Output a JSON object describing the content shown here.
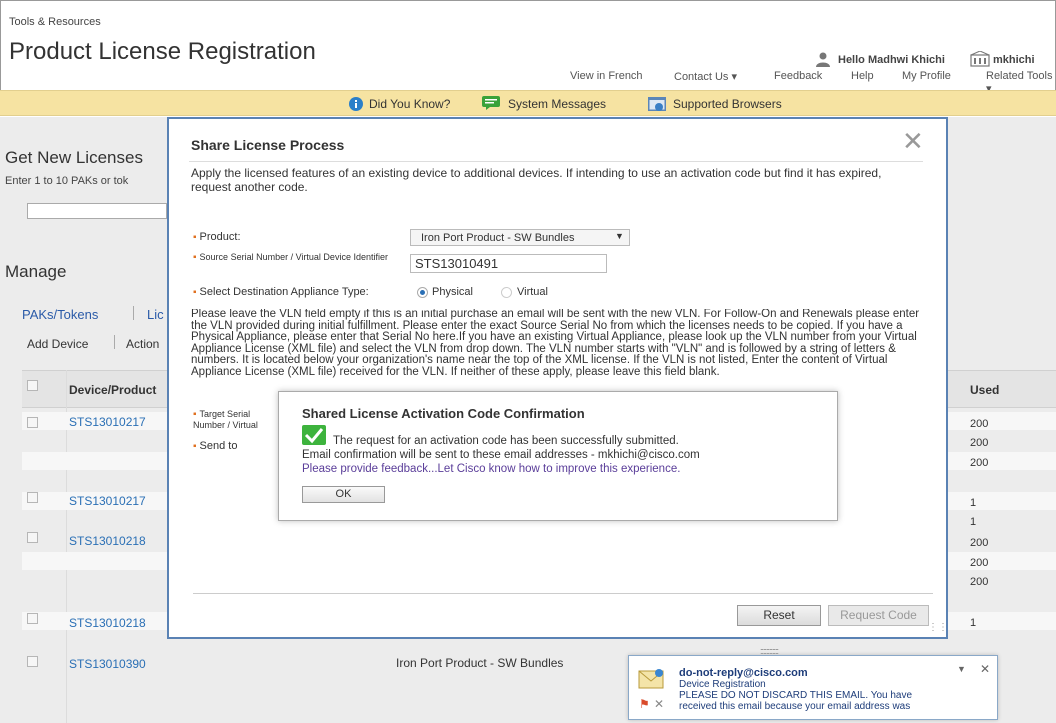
{
  "header": {
    "breadcrumb": "Tools & Resources",
    "title": "Product License Registration",
    "hello_user": "Hello Madhwi Khichi",
    "username": "mkhichi",
    "nav_links": [
      "View in French",
      "Contact Us ▾",
      "Feedback",
      "Help",
      "My Profile",
      "Related Tools ▾"
    ]
  },
  "info_bar": {
    "did_you_know": "Did You Know?",
    "system_messages": "System Messages",
    "supported_browsers": "Supported Browsers"
  },
  "background": {
    "get_new_licenses": "Get New Licenses",
    "enter_paks": "Enter 1 to 10 PAKs or tok",
    "manage": "Manage",
    "tab_paks": "PAKs/Tokens",
    "tab_lic": "Lic",
    "add_device": "Add Device",
    "action": "Action",
    "col_device": "Device/Product",
    "col_used": "Used",
    "rows": [
      {
        "device": "STS13010217",
        "used": "200"
      },
      {
        "device": "",
        "used": "200"
      },
      {
        "device": "",
        "used": "200"
      },
      {
        "device": "STS13010217",
        "used": "1"
      },
      {
        "device": "",
        "used": "1"
      },
      {
        "device": "STS13010218",
        "used": "200"
      },
      {
        "device": "",
        "used": "200"
      },
      {
        "device": "",
        "used": "200"
      },
      {
        "device": "STS13010218",
        "used": "1"
      },
      {
        "device": "STS13010390",
        "used": ""
      }
    ],
    "row_product": "Iron Port Product - SW Bundles"
  },
  "modal": {
    "title": "Share License Process",
    "close": "✕",
    "description": "Apply the licensed features of an existing device to additional devices. If intending to use an activation code but find it has expired, request another code.",
    "product_label": "Product:",
    "product_value": "Iron Port Product - SW Bundles",
    "serial_label": "Source Serial Number / Virtual Device Identifier",
    "serial_value": "STS13010491",
    "dest_label": "Select Destination Appliance Type:",
    "dest_physical": "Physical",
    "dest_virtual": "Virtual",
    "vln_text": "Please leave the VLN field empty if this is an initial purchase an email will be sent with the new VLN. For Follow-On and Renewals please enter the VLN provided during initial fulfillment. Please enter the exact Source Serial No from which the licenses needs to be copied. If you have a Physical Appliance, please enter that Serial No here.If you have an existing Virtual Appliance, please look up the VLN number from your Virtual Appliance License (XML file) and select the VLN from drop down. The VLN number starts with \"VLN\" and is followed by a string of letters & numbers. It is located below your organization's name near the top of the XML license. If the VLN is not listed, Enter the content of Virtual Appliance License (XML file) received for the VLN. If neither of these apply, please leave this field blank.",
    "target_label": "Target Serial Number / Virtual Device Identifier",
    "send_to_label": "Send to",
    "reset": "Reset",
    "request_code": "Request Code"
  },
  "confirm": {
    "title": "Shared License Activation Code Confirmation",
    "msg1": "The request for an activation code has been successfully submitted.",
    "msg2": "Email confirmation will be sent to these email addresses - mkhichi@cisco.com",
    "feedback": "Please provide feedback...Let Cisco know how to improve this experience.",
    "ok": "OK"
  },
  "toast": {
    "from": "do-not-reply@cisco.com",
    "subject": "Device Registration",
    "body1": "PLEASE DO NOT DISCARD THIS EMAIL.  You have",
    "body2": "received this email because your email address was"
  },
  "colors": {
    "accent_blue": "#2a6fb5",
    "modal_border": "#5a82b4",
    "info_bar": "#f6e3a2",
    "success_green": "#3db33d",
    "required_orange": "#e07020"
  }
}
